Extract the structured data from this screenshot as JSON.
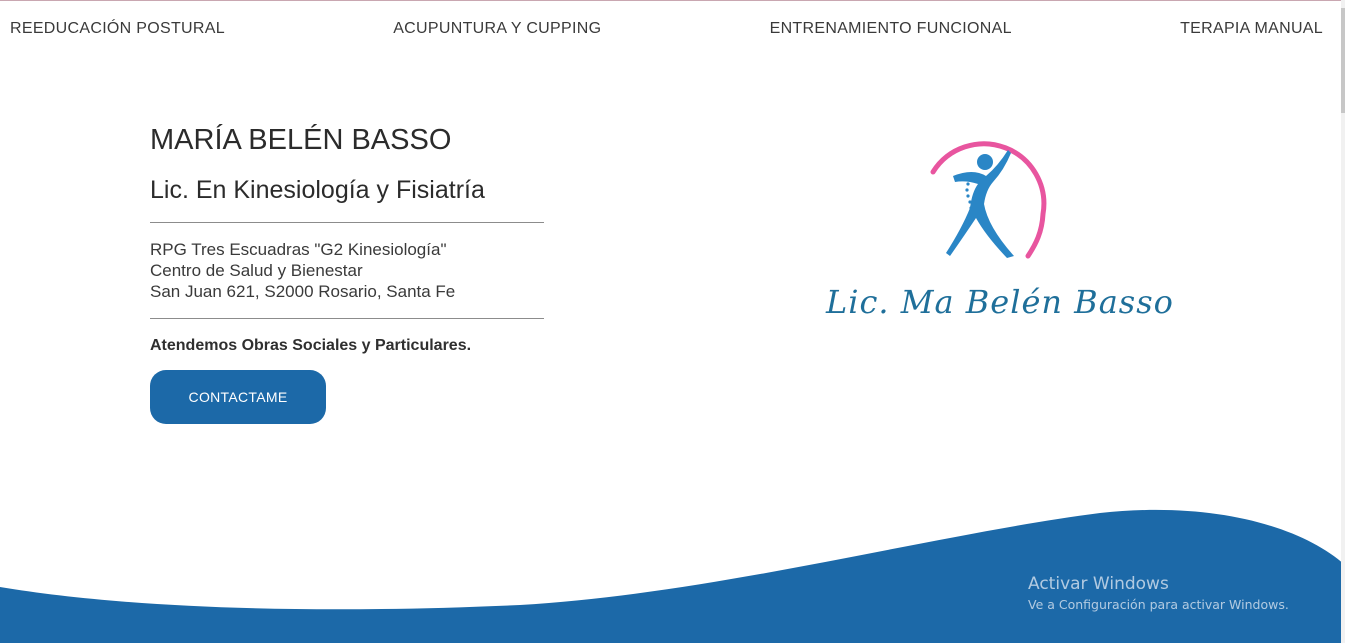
{
  "nav": {
    "items": [
      {
        "label": "REEDUCACIÓN POSTURAL"
      },
      {
        "label": "ACUPUNTURA Y CUPPING"
      },
      {
        "label": "ENTRENAMIENTO FUNCIONAL"
      },
      {
        "label": "TERAPIA MANUAL"
      }
    ]
  },
  "hero": {
    "name": "MARÍA BELÉN BASSO",
    "title": "Lic. En Kinesiología y Fisiatría",
    "address_lines": [
      "RPG Tres Escuadras \"G2 Kinesiología\"",
      "Centro de Salud y Bienestar",
      "San Juan 621, S2000 Rosario, Santa Fe"
    ],
    "notice": "Atendemos Obras Sociales y Particulares.",
    "cta_label": "CONTACTAME"
  },
  "logo": {
    "signature": "Lic. Ma Belén Basso",
    "icon": "figure-with-spine-and-arc-icon",
    "colors": {
      "arc": "#e8559f",
      "figure": "#2a86c6",
      "signature": "#1f6f9a"
    }
  },
  "theme": {
    "primary": "#1c69a8",
    "wave": "#1c69a8",
    "text": "#2b2b2b"
  },
  "watermark": {
    "title": "Activar Windows",
    "subtitle": "Ve a Configuración para activar Windows."
  }
}
